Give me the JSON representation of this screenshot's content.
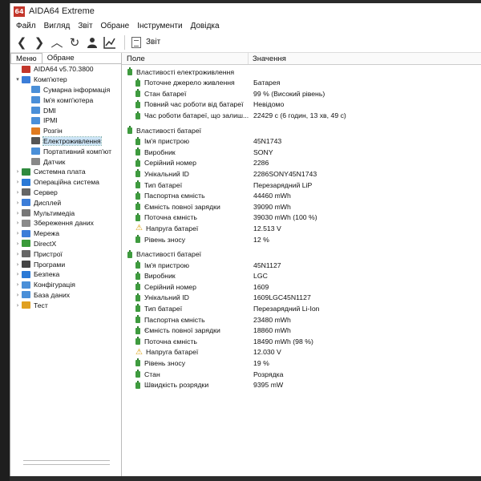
{
  "window": {
    "title": "AIDA64 Extreme",
    "icon_text": "64"
  },
  "menu": [
    "Файл",
    "Вигляд",
    "Звіт",
    "Обране",
    "Інструменти",
    "Довідка"
  ],
  "toolbar": {
    "report_label": "Звіт"
  },
  "left_tabs": [
    "Меню",
    "Обране"
  ],
  "tree": [
    {
      "label": "AIDA64 v5.70.3800",
      "level": 0,
      "arrow": "",
      "icon_color": "#c3362b",
      "icon": "aida64-icon"
    },
    {
      "label": "Комп'ютер",
      "level": 0,
      "arrow": "▾",
      "icon_color": "#3b7dd8",
      "icon": "computer-icon"
    },
    {
      "label": "Сумарна інформація",
      "level": 1,
      "arrow": "",
      "icon_color": "#4a8fd8",
      "icon": "summary-icon"
    },
    {
      "label": "Ім'я комп'ютера",
      "level": 1,
      "arrow": "",
      "icon_color": "#4a8fd8",
      "icon": "computer-name-icon"
    },
    {
      "label": "DMI",
      "level": 1,
      "arrow": "",
      "icon_color": "#4a8fd8",
      "icon": "dmi-icon"
    },
    {
      "label": "IPMI",
      "level": 1,
      "arrow": "",
      "icon_color": "#4a8fd8",
      "icon": "ipmi-icon"
    },
    {
      "label": "Розгін",
      "level": 1,
      "arrow": "",
      "icon_color": "#e07b20",
      "icon": "overclock-icon"
    },
    {
      "label": "Електроживлення",
      "level": 1,
      "arrow": "",
      "icon_color": "#555555",
      "icon": "power-icon",
      "selected": true
    },
    {
      "label": "Портативний комп'ют",
      "level": 1,
      "arrow": "",
      "icon_color": "#4a8fd8",
      "icon": "laptop-icon"
    },
    {
      "label": "Датчик",
      "level": 1,
      "arrow": "",
      "icon_color": "#888888",
      "icon": "sensor-icon"
    },
    {
      "label": "Системна плата",
      "level": 0,
      "arrow": "›",
      "icon_color": "#2f8a3e",
      "icon": "motherboard-icon"
    },
    {
      "label": "Операційна система",
      "level": 0,
      "arrow": "›",
      "icon_color": "#2a79d6",
      "icon": "os-icon"
    },
    {
      "label": "Сервер",
      "level": 0,
      "arrow": "›",
      "icon_color": "#666666",
      "icon": "server-icon"
    },
    {
      "label": "Дисплей",
      "level": 0,
      "arrow": "›",
      "icon_color": "#3b7dd8",
      "icon": "display-icon"
    },
    {
      "label": "Мультимедіа",
      "level": 0,
      "arrow": "›",
      "icon_color": "#777777",
      "icon": "multimedia-icon"
    },
    {
      "label": "Збереження даних",
      "level": 0,
      "arrow": "›",
      "icon_color": "#8a8a8a",
      "icon": "storage-icon"
    },
    {
      "label": "Мережа",
      "level": 0,
      "arrow": "›",
      "icon_color": "#3b7dd8",
      "icon": "network-icon"
    },
    {
      "label": "DirectX",
      "level": 0,
      "arrow": "›",
      "icon_color": "#3a9a3a",
      "icon": "directx-icon"
    },
    {
      "label": "Пристрої",
      "level": 0,
      "arrow": "›",
      "icon_color": "#666666",
      "icon": "devices-icon"
    },
    {
      "label": "Програми",
      "level": 0,
      "arrow": "›",
      "icon_color": "#444444",
      "icon": "programs-icon"
    },
    {
      "label": "Безпека",
      "level": 0,
      "arrow": "›",
      "icon_color": "#2a79d6",
      "icon": "security-icon"
    },
    {
      "label": "Конфігурація",
      "level": 0,
      "arrow": "›",
      "icon_color": "#4a8fd8",
      "icon": "config-icon"
    },
    {
      "label": "База даних",
      "level": 0,
      "arrow": "›",
      "icon_color": "#4a8fd8",
      "icon": "database-icon"
    },
    {
      "label": "Тест",
      "level": 0,
      "arrow": "›",
      "icon_color": "#e0a020",
      "icon": "benchmark-icon"
    }
  ],
  "columns": {
    "field": "Поле",
    "value": "Значення"
  },
  "groups": [
    {
      "title": "Властивості електроживлення",
      "rows": [
        {
          "field": "Поточне джерело живлення",
          "value": "Батарея",
          "icon": "battery"
        },
        {
          "field": "Стан батареї",
          "value": "99 % (Високий рівень)",
          "icon": "battery"
        },
        {
          "field": "Повний час роботи від батареї",
          "value": "Невідомо",
          "icon": "battery"
        },
        {
          "field": "Час роботи батареї, що залиш...",
          "value": "22429 с (6 годин, 13 хв, 49 с)",
          "icon": "battery"
        }
      ]
    },
    {
      "title": "Властивості батареї",
      "rows": [
        {
          "field": "Ім'я пристрою",
          "value": "45N1743",
          "icon": "battery"
        },
        {
          "field": "Виробник",
          "value": "SONY",
          "icon": "battery"
        },
        {
          "field": "Серійний номер",
          "value": "2286",
          "icon": "battery"
        },
        {
          "field": "Унікальний ID",
          "value": "2286SONY45N1743",
          "icon": "battery"
        },
        {
          "field": "Тип батареї",
          "value": "Перезарядний LiP",
          "icon": "battery"
        },
        {
          "field": "Паспортна ємність",
          "value": "44460 mWh",
          "icon": "battery"
        },
        {
          "field": "Ємність повної зарядки",
          "value": "39090 mWh",
          "icon": "battery"
        },
        {
          "field": "Поточна ємність",
          "value": "39030 mWh  (100 %)",
          "icon": "battery"
        },
        {
          "field": "Напруга батареї",
          "value": "12.513 V",
          "icon": "warning"
        },
        {
          "field": "Рівень зносу",
          "value": "12 %",
          "icon": "battery"
        }
      ]
    },
    {
      "title": "Властивості батареї",
      "rows": [
        {
          "field": "Ім'я пристрою",
          "value": "45N1127",
          "icon": "battery"
        },
        {
          "field": "Виробник",
          "value": "LGC",
          "icon": "battery"
        },
        {
          "field": "Серійний номер",
          "value": "1609",
          "icon": "battery"
        },
        {
          "field": "Унікальний ID",
          "value": "1609LGC45N1127",
          "icon": "battery"
        },
        {
          "field": "Тип батареї",
          "value": "Перезарядний Li-Ion",
          "icon": "battery"
        },
        {
          "field": "Паспортна ємність",
          "value": "23480 mWh",
          "icon": "battery"
        },
        {
          "field": "Ємність повної зарядки",
          "value": "18860 mWh",
          "icon": "battery"
        },
        {
          "field": "Поточна ємність",
          "value": "18490 mWh  (98 %)",
          "icon": "battery"
        },
        {
          "field": "Напруга батареї",
          "value": "12.030 V",
          "icon": "warning"
        },
        {
          "field": "Рівень зносу",
          "value": "19 %",
          "icon": "battery"
        },
        {
          "field": "Стан",
          "value": "Розрядка",
          "icon": "battery"
        },
        {
          "field": "Швидкість розрядки",
          "value": "9395 mW",
          "icon": "battery"
        }
      ]
    }
  ]
}
